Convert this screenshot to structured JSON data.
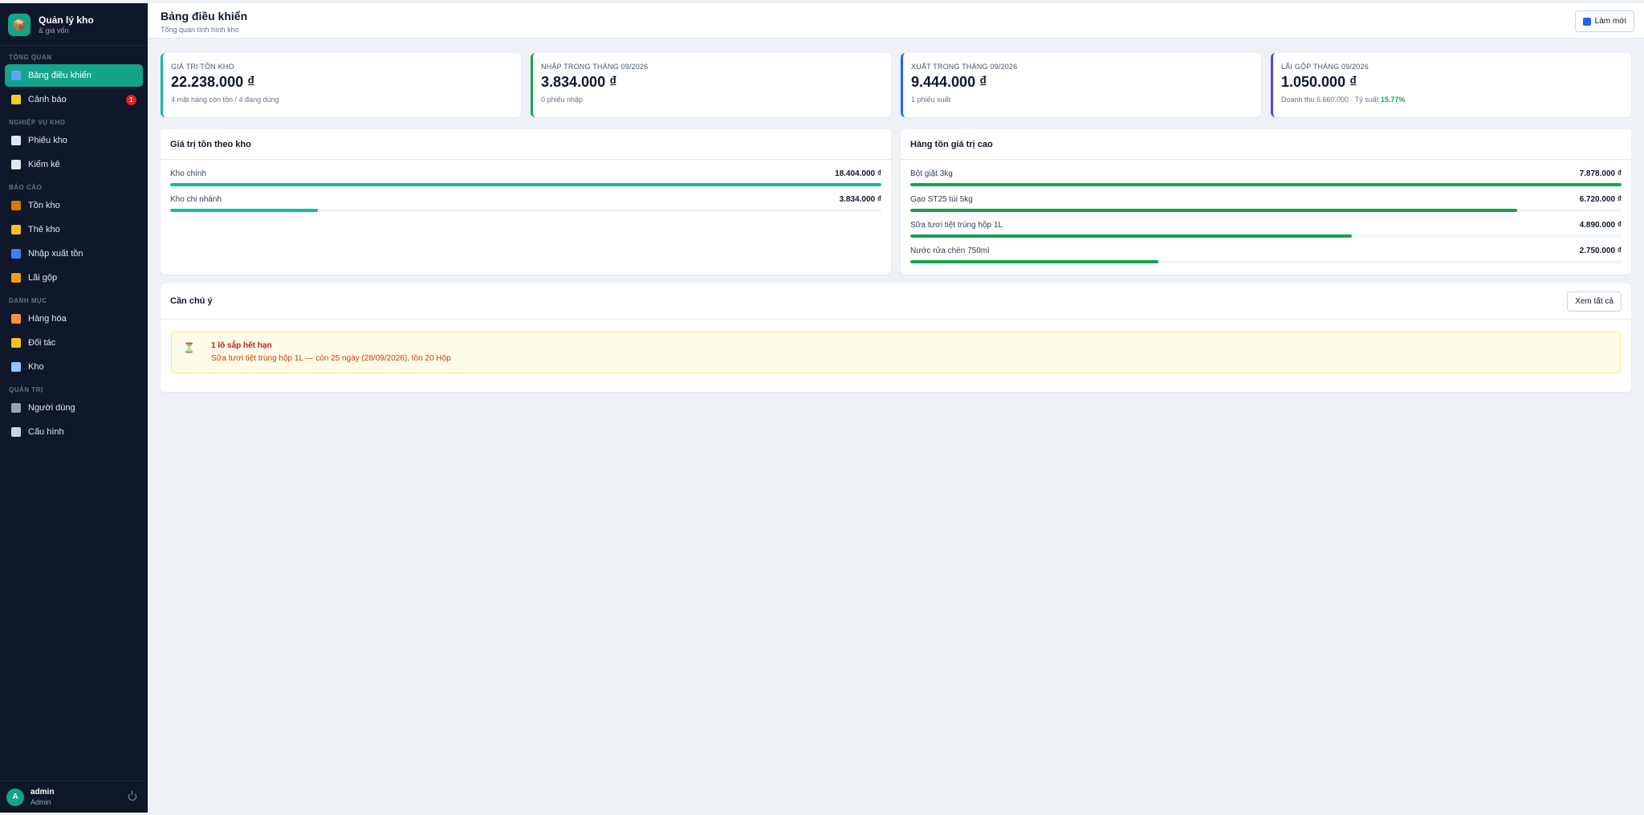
{
  "brand": {
    "title": "Quản lý kho",
    "subtitle": "& giá vốn"
  },
  "sidebar": {
    "sections": [
      {
        "label": "Tổng quan",
        "items": [
          {
            "label": "Bảng điều khiển",
            "icon": "chart-icon",
            "active": true
          },
          {
            "label": "Cảnh báo",
            "icon": "bell-icon",
            "badge": "1"
          }
        ]
      },
      {
        "label": "Nghiệp vụ kho",
        "items": [
          {
            "label": "Phiếu kho",
            "icon": "clipboard-icon"
          },
          {
            "label": "Kiểm kê",
            "icon": "document-icon"
          }
        ]
      },
      {
        "label": "Báo cáo",
        "items": [
          {
            "label": "Tồn kho",
            "icon": "box-icon"
          },
          {
            "label": "Thẻ kho",
            "icon": "card-icon"
          },
          {
            "label": "Nhập xuất tồn",
            "icon": "exchange-icon"
          },
          {
            "label": "Lãi gộp",
            "icon": "money-bag-icon"
          }
        ]
      },
      {
        "label": "Danh mục",
        "items": [
          {
            "label": "Hàng hóa",
            "icon": "tag-icon"
          },
          {
            "label": "Đối tác",
            "icon": "handshake-icon"
          },
          {
            "label": "Kho",
            "icon": "building-icon"
          }
        ]
      },
      {
        "label": "Quản trị",
        "items": [
          {
            "label": "Người dùng",
            "icon": "users-icon"
          },
          {
            "label": "Cấu hình",
            "icon": "gear-icon"
          }
        ]
      }
    ]
  },
  "user": {
    "initial": "A",
    "name": "admin",
    "role": "Admin"
  },
  "header": {
    "title": "Bảng điều khiển",
    "subtitle": "Tổng quan tình hình kho",
    "refresh_label": "Làm mới"
  },
  "stats": [
    {
      "label": "Giá trị tồn kho",
      "value": "22.238.000 ₫",
      "note": "4 mặt hàng còn tồn / 4 đang dùng",
      "color": "#14b8a6"
    },
    {
      "label": "Nhập trong tháng 09/2026",
      "value": "3.834.000 ₫",
      "note": "0 phiếu nhập",
      "color": "#16a34a"
    },
    {
      "label": "Xuất trong tháng 09/2026",
      "value": "9.444.000 ₫",
      "note": "1 phiếu xuất",
      "color": "#2563eb"
    },
    {
      "label": "Lãi gộp tháng 09/2026",
      "value": "1.050.000 ₫",
      "note": "Doanh thu 6.660.000 · Tỷ suất ",
      "pct": "15.77%",
      "color": "#4f46e5"
    }
  ],
  "warehouse_panel": {
    "title": "Giá trị tồn theo kho",
    "rows": [
      {
        "name": "Kho chính",
        "value": "18.404.000 ₫",
        "fraction": 1.0
      },
      {
        "name": "Kho chi nhánh",
        "value": "3.834.000 ₫",
        "fraction": 0.208
      }
    ],
    "bar_color": "#14b8a6"
  },
  "top_items_panel": {
    "title": "Hàng tồn giá trị cao",
    "rows": [
      {
        "name": "Bột giặt 3kg",
        "value": "7.878.000 ₫",
        "fraction": 1.0
      },
      {
        "name": "Gạo ST25 túi 5kg",
        "value": "6.720.000 ₫",
        "fraction": 0.853
      },
      {
        "name": "Sữa tươi tiệt trùng hộp 1L",
        "value": "4.890.000 ₫",
        "fraction": 0.621
      },
      {
        "name": "Nước rửa chén 750ml",
        "value": "2.750.000 ₫",
        "fraction": 0.349
      }
    ],
    "bar_color": "#16a34a"
  },
  "attention": {
    "title": "Cần chú ý",
    "view_all_label": "Xem tất cả",
    "alert_title": "1 lô sắp hết hạn",
    "alert_text": "Sữa tươi tiệt trùng hộp 1L — còn 25 ngày (28/09/2026), tồn 20 Hộp",
    "alert_icon": "hourglass-icon"
  }
}
